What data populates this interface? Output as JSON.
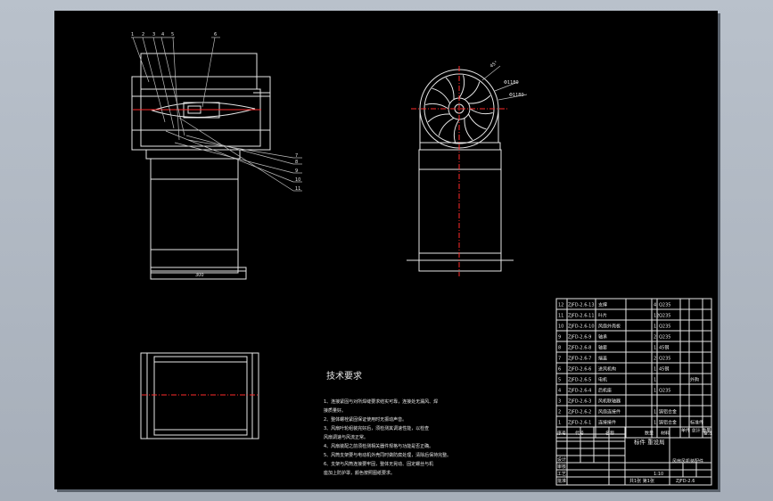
{
  "notes": {
    "title": "技术要求",
    "lines": [
      "1、连接紧固与对所焊缝要求结实可靠，连接处无漏风、焊",
      "接质量好。",
      "2、整体螺栓紧固保证使用时无振动声音。",
      "3、风扇叶轮组装完好后，须检测其调速性能，以检查",
      "风扇调速与风流正常。",
      "4、风扇装配之前须检测相关器件规格与功能是否正确。",
      "5、风筒支架要与电动机外壳同时做防腐处理，清除后保持完整。",
      "6、支架与风筒连接要牢固，整体无晃动、固定螺丝与机",
      "座加上防护罩，颜色按照图纸要求。"
    ]
  },
  "side_view_labels": [
    "1",
    "2",
    "3",
    "4",
    "5",
    "6"
  ],
  "right_leaders": [
    "7",
    "8",
    "9",
    "10",
    "11"
  ],
  "dimensions": {
    "front_width": "300",
    "fan_dia_1": "Φ1180",
    "fan_dia_2": "Φ1180",
    "angle": "45°"
  },
  "bom": {
    "rows": [
      {
        "no": "12",
        "code": "ZJFD-2.6-13",
        "name": "支撑",
        "qty": "4",
        "material": "Q235",
        "remark": ""
      },
      {
        "no": "11",
        "code": "ZJFD-2.6-11",
        "name": "叶片",
        "qty": "12",
        "material": "Q235",
        "remark": ""
      },
      {
        "no": "10",
        "code": "ZJFD-2.6-10",
        "name": "风扇外壳板",
        "qty": "1",
        "material": "Q235",
        "remark": ""
      },
      {
        "no": "9",
        "code": "ZJFD-2.6-9",
        "name": "轴承",
        "qty": "2",
        "material": "Q235",
        "remark": ""
      },
      {
        "no": "8",
        "code": "ZJFD-2.6-8",
        "name": "轴套",
        "qty": "1",
        "material": "45钢",
        "remark": ""
      },
      {
        "no": "7",
        "code": "ZJFD-2.6-7",
        "name": "端盖",
        "qty": "2",
        "material": "Q235",
        "remark": ""
      },
      {
        "no": "6",
        "code": "ZJFD-2.6-6",
        "name": "进风机构",
        "qty": "1",
        "material": "45钢",
        "remark": ""
      },
      {
        "no": "5",
        "code": "ZJFD-2.6-5",
        "name": "电机",
        "qty": "1",
        "material": "",
        "remark": "外购"
      },
      {
        "no": "4",
        "code": "ZJFD-2.6-4",
        "name": "后机座",
        "qty": "1",
        "material": "Q235",
        "remark": ""
      },
      {
        "no": "3",
        "code": "ZJFD-2.6-3",
        "name": "风机联轴器",
        "qty": "",
        "material": "",
        "remark": ""
      },
      {
        "no": "2",
        "code": "ZJFD-2.6-2",
        "name": "风扇连接件",
        "qty": "1",
        "material": "铸铝合金",
        "remark": ""
      },
      {
        "no": "1",
        "code": "ZJFD-2.6-1",
        "name": "连接接件",
        "qty": "1",
        "material": "铸铝合金",
        "remark": "标准件"
      }
    ],
    "header": {
      "no": "序号",
      "code": "代号",
      "name": "名称",
      "qty": "数量",
      "material": "材料",
      "weight": "单件 总计 重量",
      "remark": "备注"
    }
  },
  "title_block": {
    "company": "标件 重设局",
    "drawing_name": "风扇风机装配件",
    "drawing_no": "ZJFD-2.6",
    "scale": "1:10",
    "sheet": "共1张 第1张",
    "signers": [
      "设计",
      "审核",
      "工艺",
      "批准"
    ]
  }
}
